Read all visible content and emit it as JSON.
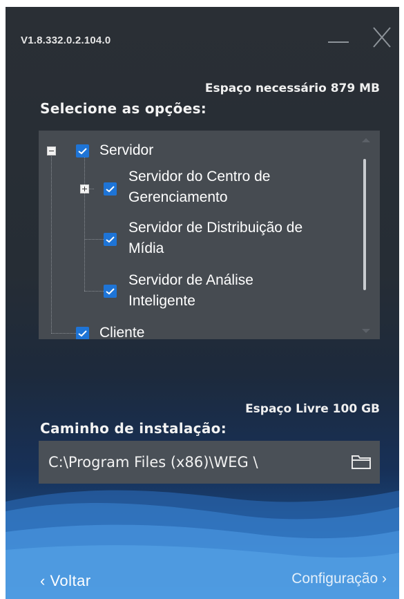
{
  "window": {
    "version": "V1.8.332.0.2.104.0"
  },
  "options": {
    "space_required": "Espaço necessário 879 MB",
    "title": "Selecione as opções:",
    "tree": [
      {
        "id": "servidor",
        "label": "Servidor",
        "checked": true,
        "expanded": true
      },
      {
        "id": "centro",
        "label_line1": "Servidor do Centro de",
        "label_line2": "Gerenciamento",
        "checked": true,
        "expanded": false
      },
      {
        "id": "distribuicao",
        "label_line1": "Servidor de Distribuição de",
        "label_line2": "Mídia",
        "checked": true
      },
      {
        "id": "analise",
        "label_line1": "Servidor de Análise",
        "label_line2": "Inteligente",
        "checked": true
      },
      {
        "id": "cliente",
        "label": "Cliente",
        "checked": true
      }
    ]
  },
  "install": {
    "space_free": "Espaço Livre 100 GB",
    "title": "Caminho de instalação:",
    "path_value": "C:\\Program Files (x86)\\WEG \\"
  },
  "footer": {
    "back_label": "‹ Voltar",
    "next_label": "Configuração ›"
  },
  "colors": {
    "accent": "#1e74d6",
    "panel": "#464b51",
    "background_top": "#2a2f35",
    "background_bottom": "#1a5fa6"
  },
  "icons": {
    "minimize": "minimize-icon",
    "close": "close-icon",
    "folder": "folder-icon",
    "check": "check-icon"
  }
}
